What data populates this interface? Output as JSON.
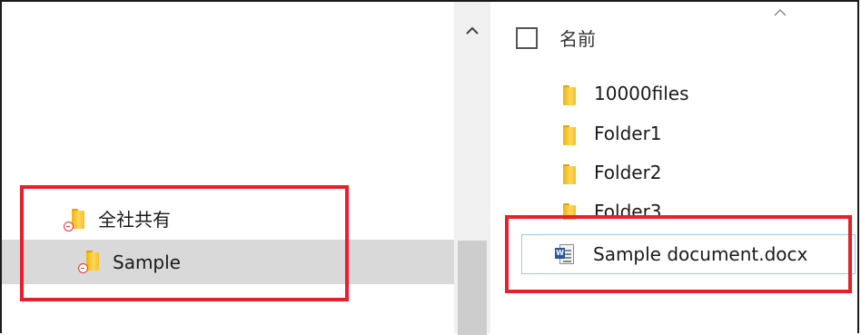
{
  "nav": {
    "items": [
      {
        "label": "全社共有"
      },
      {
        "label": "Sample"
      }
    ]
  },
  "content": {
    "header": {
      "name_label": "名前"
    },
    "rows": [
      {
        "label": "10000files"
      },
      {
        "label": "Folder1"
      },
      {
        "label": "Folder2"
      },
      {
        "label": "Folder3"
      }
    ],
    "selected_file": {
      "label": "Sample document.docx",
      "badge": "W"
    }
  },
  "colors": {
    "highlight": "#e8202a",
    "folder": "#f5c026",
    "selection_bg": "#d9d9d9",
    "file_selection_border": "#99c9ef"
  },
  "icons": {
    "sort": "chevron-up-icon",
    "scroll_up": "caret-up-icon",
    "folder": "folder-icon",
    "sync": "sync-error-icon",
    "document": "word-document-icon"
  }
}
